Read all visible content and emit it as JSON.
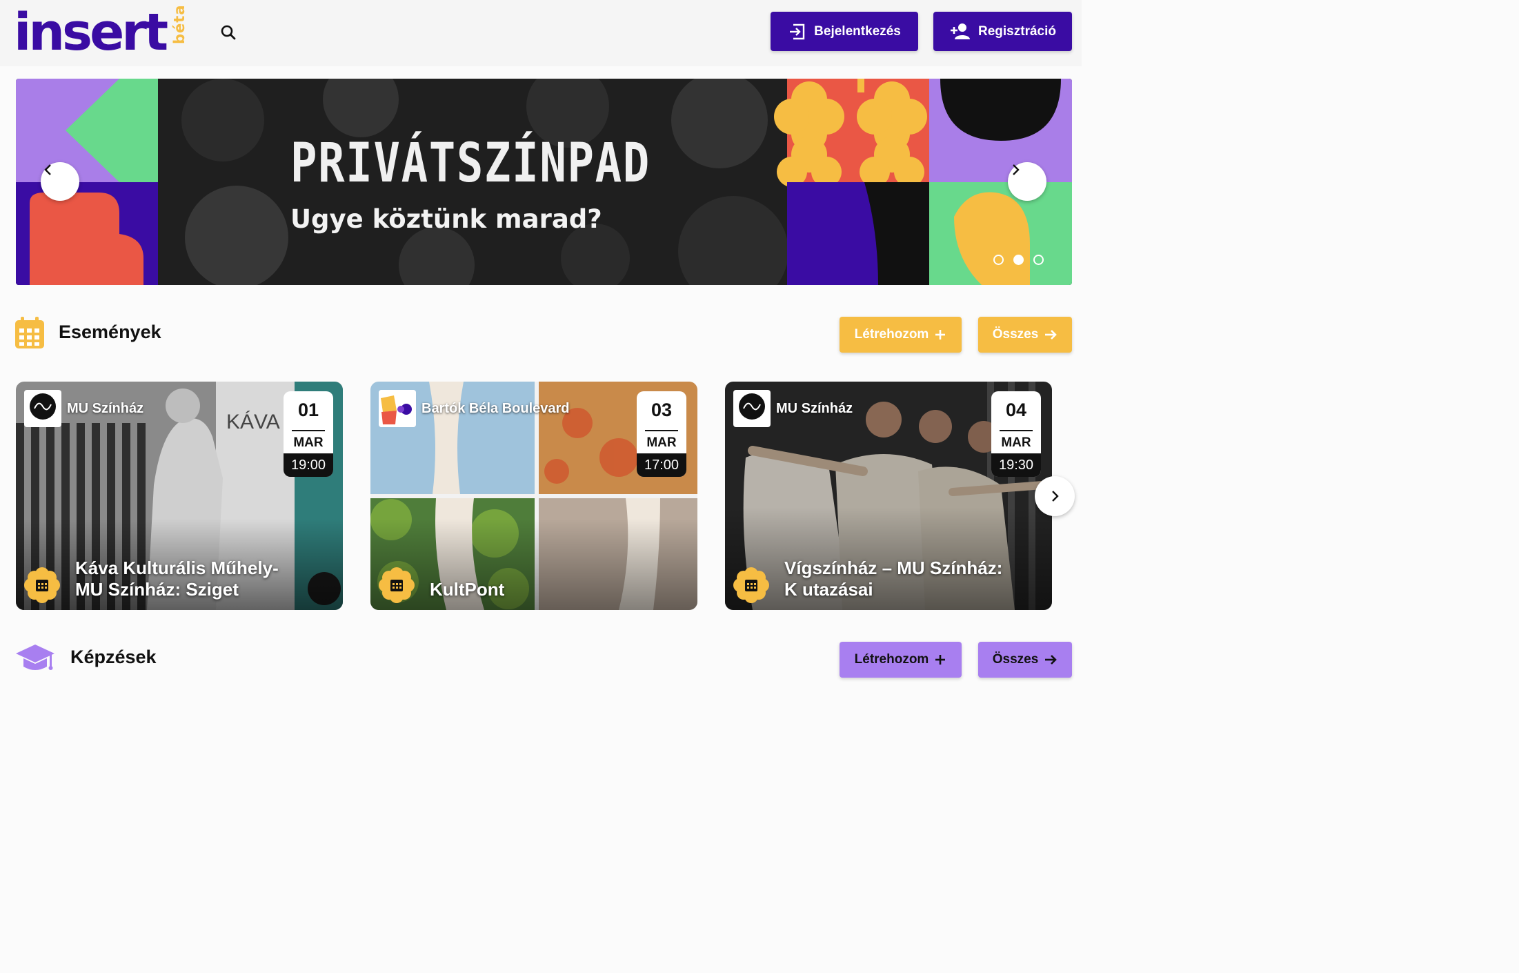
{
  "header": {
    "logo_text": "insert",
    "logo_badge": "béta",
    "search_icon": "search-icon",
    "login_label": "Bejelentkezés",
    "register_label": "Regisztráció",
    "brand_color": "#3a0ca3"
  },
  "banner": {
    "title": "PRIVÁTSZÍNPAD",
    "subtitle": "Ugye köztünk marad?",
    "slide_count": 3,
    "active_slide": 2
  },
  "events": {
    "title": "Események",
    "create_label": "Létrehozom",
    "all_label": "Összes",
    "accent_color": "#f6bd43",
    "cards": [
      {
        "organizer": "MU Színház",
        "day": "01",
        "month": "MAR",
        "time": "19:00",
        "title_line1": "Káva Kulturális Műhely-",
        "title_line2": "MU Színház: Sziget"
      },
      {
        "organizer": "Bartók Béla Boulevard",
        "day": "03",
        "month": "MAR",
        "time": "17:00",
        "title_line1": "",
        "title_line2": "KultPont"
      },
      {
        "organizer": "MU Színház",
        "day": "04",
        "month": "MAR",
        "time": "19:30",
        "title_line1": "Vígszínház – MU Színház:",
        "title_line2": "K utazásai"
      }
    ]
  },
  "trainings": {
    "title": "Képzések",
    "create_label": "Létrehozom",
    "all_label": "Összes",
    "accent_color": "#a87ff0"
  }
}
